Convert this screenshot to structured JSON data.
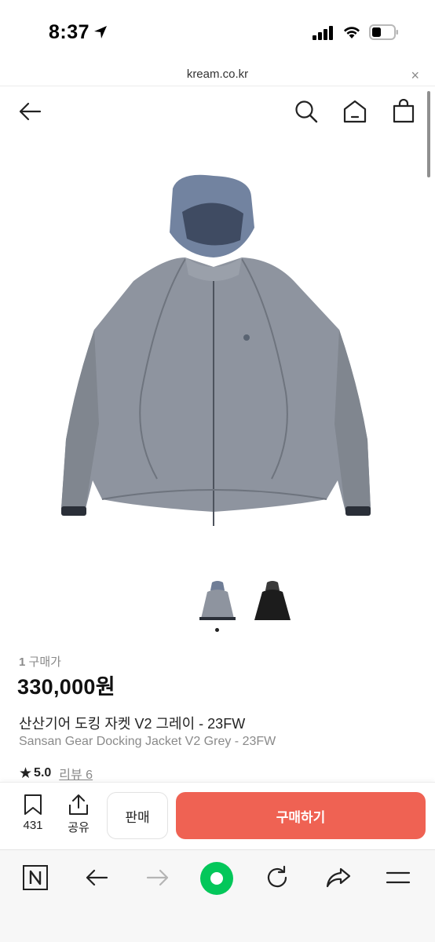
{
  "status_bar": {
    "time": "8:37",
    "icons": [
      "location-arrow-icon",
      "cellular-signal-icon",
      "wifi-icon",
      "battery-icon"
    ]
  },
  "browser": {
    "url": "kream.co.kr",
    "close_glyph": "×"
  },
  "header": {
    "icons": [
      "back-arrow-icon",
      "search-icon",
      "home-icon",
      "shopping-bag-icon"
    ]
  },
  "product": {
    "image_alt": "product-photo-grey-jacket",
    "thumbnails": [
      "grey",
      "black"
    ],
    "selected_thumbnail": 0,
    "trade_count_value": "1",
    "trade_count_label": "구매가",
    "price": "330,000원",
    "name_ko": "산산기어 도킹 자켓 V2 그레이 - 23FW",
    "name_en": "Sansan Gear Docking Jacket V2 Grey - 23FW",
    "rating": "5.0",
    "review_label": "리뷰 6"
  },
  "actions": {
    "bookmark_count": "431",
    "share_label": "공유",
    "sell_label": "판매",
    "buy_label": "구매하기"
  },
  "colors": {
    "buy_button": "#ef6253",
    "naver_green": "#03c75a"
  },
  "browser_toolbar": {
    "items": [
      "naver-n-icon",
      "back-icon",
      "forward-icon",
      "green-home-icon",
      "refresh-icon",
      "share-icon",
      "menu-icon"
    ]
  }
}
